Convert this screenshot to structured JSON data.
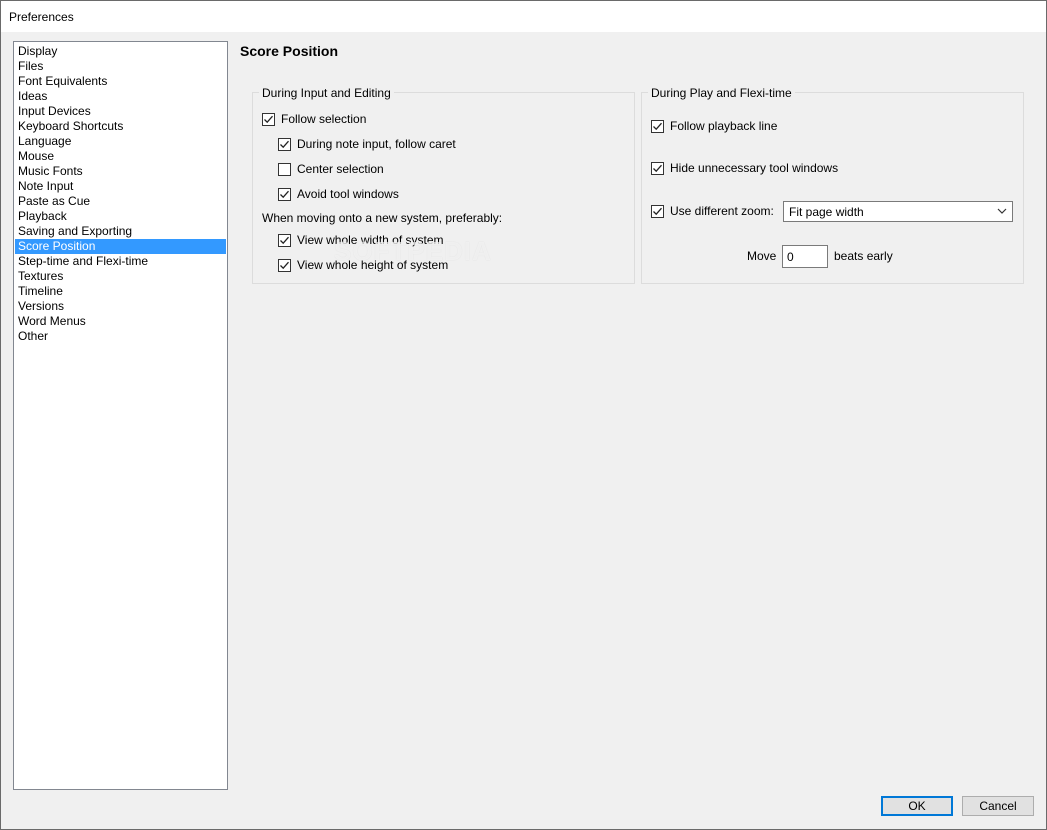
{
  "window": {
    "title": "Preferences"
  },
  "categories": {
    "items": [
      {
        "label": "Display"
      },
      {
        "label": "Files"
      },
      {
        "label": "Font Equivalents"
      },
      {
        "label": "Ideas"
      },
      {
        "label": "Input Devices"
      },
      {
        "label": "Keyboard Shortcuts"
      },
      {
        "label": "Language"
      },
      {
        "label": "Mouse"
      },
      {
        "label": "Music Fonts"
      },
      {
        "label": "Note Input"
      },
      {
        "label": "Paste as Cue"
      },
      {
        "label": "Playback"
      },
      {
        "label": "Saving and Exporting"
      },
      {
        "label": "Score Position"
      },
      {
        "label": "Step-time and Flexi-time"
      },
      {
        "label": "Textures"
      },
      {
        "label": "Timeline"
      },
      {
        "label": "Versions"
      },
      {
        "label": "Word Menus"
      },
      {
        "label": "Other"
      }
    ],
    "selected_index": 13
  },
  "page": {
    "title": "Score Position"
  },
  "input_group": {
    "label": "During Input and Editing",
    "follow_selection": {
      "label": "Follow selection",
      "checked": true
    },
    "follow_caret": {
      "label": "During note input, follow caret",
      "checked": true
    },
    "center_selection": {
      "label": "Center selection",
      "checked": false
    },
    "avoid_tool_windows": {
      "label": "Avoid tool windows",
      "checked": true
    },
    "new_system_text": "When moving onto a new system, preferably:",
    "view_whole_width": {
      "label": "View whole width of system",
      "checked": true
    },
    "view_whole_height": {
      "label": "View whole height of system",
      "checked": true
    }
  },
  "play_group": {
    "label": "During Play and Flexi-time",
    "follow_playback": {
      "label": "Follow playback line",
      "checked": true
    },
    "hide_tool_windows": {
      "label": "Hide unnecessary tool windows",
      "checked": true
    },
    "use_zoom": {
      "label": "Use different zoom:",
      "checked": true
    },
    "zoom_value": "Fit page width",
    "move_label": "Move",
    "move_value": "0",
    "beats_label": "beats early"
  },
  "buttons": {
    "ok": "OK",
    "cancel": "Cancel"
  },
  "watermark": "SOFTPEDIA",
  "colors": {
    "selection": "#3399ff",
    "default_button_border": "#0078d7",
    "dialog_background": "#f0f0f0"
  }
}
